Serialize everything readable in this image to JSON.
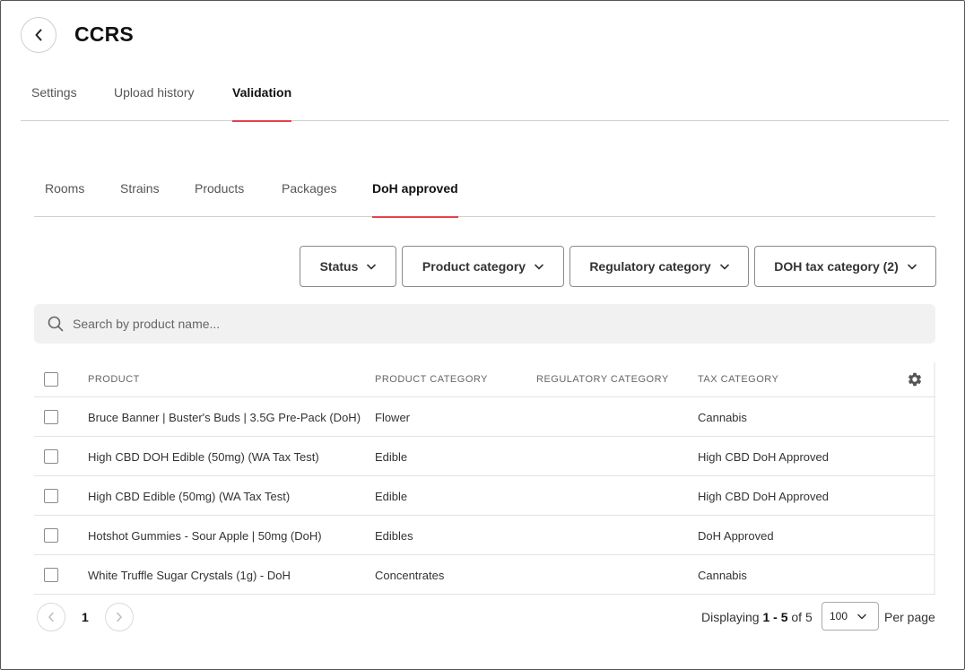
{
  "header": {
    "title": "CCRS"
  },
  "top_tabs": [
    {
      "label": "Settings",
      "active": false
    },
    {
      "label": "Upload history",
      "active": false
    },
    {
      "label": "Validation",
      "active": true
    }
  ],
  "sub_tabs": [
    {
      "label": "Rooms",
      "active": false
    },
    {
      "label": "Strains",
      "active": false
    },
    {
      "label": "Products",
      "active": false
    },
    {
      "label": "Packages",
      "active": false
    },
    {
      "label": "DoH approved",
      "active": true
    }
  ],
  "filters": [
    {
      "label": "Status"
    },
    {
      "label": "Product category"
    },
    {
      "label": "Regulatory category"
    },
    {
      "label": "DOH tax category (2)"
    }
  ],
  "search": {
    "placeholder": "Search by product name...",
    "value": ""
  },
  "table": {
    "columns": [
      "PRODUCT",
      "PRODUCT CATEGORY",
      "REGULATORY CATEGORY",
      "TAX CATEGORY"
    ],
    "rows": [
      {
        "product": "Bruce Banner | Buster's Buds | 3.5G Pre-Pack (DoH)",
        "product_category": "Flower",
        "regulatory_category": "",
        "tax_category": "Cannabis"
      },
      {
        "product": "High CBD DOH Edible (50mg) (WA Tax Test)",
        "product_category": "Edible",
        "regulatory_category": "",
        "tax_category": "High CBD DoH Approved"
      },
      {
        "product": "High CBD Edible (50mg) (WA Tax Test)",
        "product_category": "Edible",
        "regulatory_category": "",
        "tax_category": "High CBD DoH Approved"
      },
      {
        "product": "Hotshot Gummies - Sour Apple | 50mg (DoH)",
        "product_category": "Edibles",
        "regulatory_category": "",
        "tax_category": "DoH Approved"
      },
      {
        "product": "White Truffle Sugar Crystals (1g) - DoH",
        "product_category": "Concentrates",
        "regulatory_category": "",
        "tax_category": "Cannabis"
      }
    ]
  },
  "pagination": {
    "current_page": "1",
    "displaying_prefix": "Displaying",
    "range": "1 - 5",
    "of_text": "of",
    "total": "5",
    "per_page_value": "100",
    "per_page_label": "Per page"
  },
  "colors": {
    "accent": "#e8404c",
    "border": "#cfcfcf",
    "search_bg": "#f1f1f1"
  }
}
